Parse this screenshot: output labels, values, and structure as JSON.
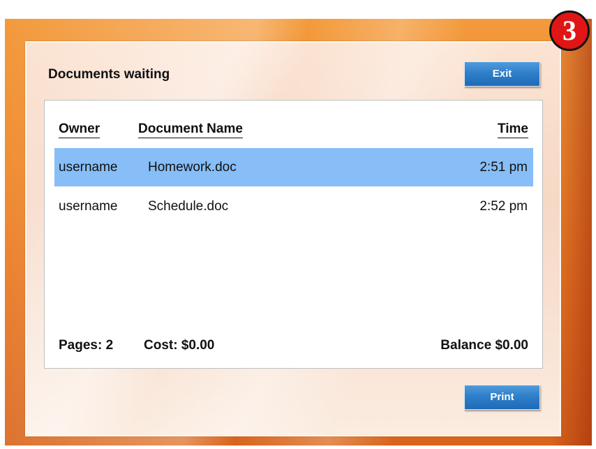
{
  "dialog": {
    "title": "Documents waiting",
    "exit_label": "Exit",
    "print_label": "Print"
  },
  "step_badge": "3",
  "table": {
    "headers": {
      "owner": "Owner",
      "document_name": "Document Name",
      "time": "Time"
    },
    "rows": [
      {
        "owner": "username",
        "document_name": "Homework.doc",
        "time": "2:51 pm",
        "selected": true
      },
      {
        "owner": "username",
        "document_name": "Schedule.doc",
        "time": "2:52 pm",
        "selected": false
      }
    ]
  },
  "summary": {
    "pages": "Pages: 2",
    "cost": "Cost: $0.00",
    "balance": "Balance $0.00"
  },
  "colors": {
    "frame_orange": "#ee8b33",
    "button_blue": "#2f7fca",
    "selection_blue": "#87bef7",
    "badge_red": "#e01616"
  }
}
